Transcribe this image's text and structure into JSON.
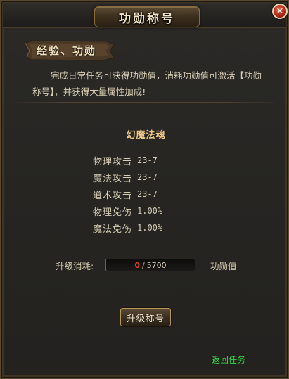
{
  "window": {
    "title": "功勋称号",
    "close_glyph": "✕"
  },
  "section": {
    "heading": "经验、功勋"
  },
  "description": "完成日常任务可获得功勋值，消耗功勋值可激活【功勋称号】，并获得大量属性加成!",
  "rank": {
    "name": "幻魔法魂"
  },
  "attributes": [
    {
      "label": "物理攻击",
      "value": "23-7"
    },
    {
      "label": "魔法攻击",
      "value": "23-7"
    },
    {
      "label": "道术攻击",
      "value": "23-7"
    },
    {
      "label": "物理免伤",
      "value": "1.00%"
    },
    {
      "label": "魔法免伤",
      "value": "1.00%"
    }
  ],
  "upgrade_cost": {
    "label": "升级消耗:",
    "current": "0",
    "separator": "/",
    "required": "5700",
    "unit": "功勋值"
  },
  "buttons": {
    "upgrade": "升级称号",
    "return": "返回任务"
  },
  "colors": {
    "accent_gold": "#efc98a",
    "cost_current": "#e23b2b",
    "link_green": "#35d64b"
  },
  "icons": {
    "close": "close-icon"
  }
}
